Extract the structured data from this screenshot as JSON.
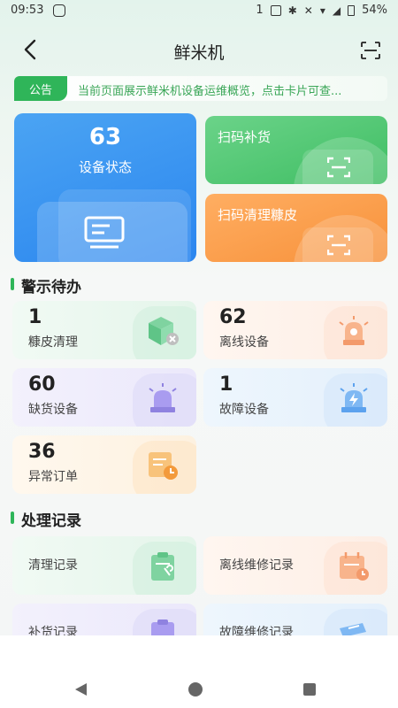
{
  "statusbar": {
    "time": "09:53",
    "sim_badge": "1",
    "battery": "54%"
  },
  "header": {
    "title": "鲜米机"
  },
  "notice": {
    "tag": "公告",
    "text": "当前页面展示鲜米机设备运维概览，点击卡片可查..."
  },
  "top_cards": {
    "device_status": {
      "count": "63",
      "label": "设备状态"
    },
    "restock": {
      "label": "扫码补货"
    },
    "clean_bran": {
      "label": "扫码清理糠皮"
    }
  },
  "sections": {
    "alerts": "警示待办",
    "records": "处理记录"
  },
  "alerts": [
    {
      "count": "1",
      "label": "糠皮清理",
      "icon": "cube-icon"
    },
    {
      "count": "62",
      "label": "离线设备",
      "icon": "alarm-light-icon"
    },
    {
      "count": "60",
      "label": "缺货设备",
      "icon": "siren-icon"
    },
    {
      "count": "1",
      "label": "故障设备",
      "icon": "fault-siren-icon"
    },
    {
      "count": "36",
      "label": "异常订单",
      "icon": "order-clock-icon"
    }
  ],
  "records": [
    {
      "label": "清理记录",
      "icon": "clipboard-wrench-icon"
    },
    {
      "label": "离线维修记录",
      "icon": "calendar-clock-icon"
    },
    {
      "label": "补货记录",
      "icon": "clipboard-icon"
    },
    {
      "label": "故障维修记录",
      "icon": "ticket-icon"
    }
  ],
  "colors": {
    "accent": "#2fb559",
    "status_blue": "#2b86ef",
    "restock_green": "#3fbe63",
    "clean_orange": "#f7913a"
  }
}
